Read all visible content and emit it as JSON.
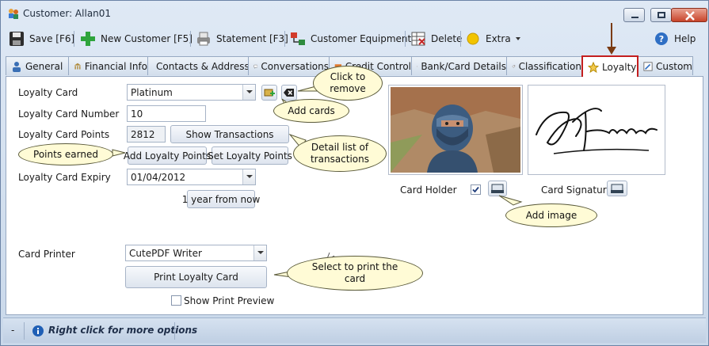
{
  "window": {
    "title": "Customer: Allan01"
  },
  "toolbar": {
    "save_label": "Save [F6]",
    "new_customer_label": "New Customer [F5]",
    "statement_label": "Statement [F3]",
    "customer_equipment_label": "Customer Equipment",
    "delete_label": "Delete",
    "extra_label": "Extra",
    "help_label": "Help"
  },
  "tabs": [
    {
      "label": "General"
    },
    {
      "label": "Financial Info"
    },
    {
      "label": "Contacts & Address"
    },
    {
      "label": "Conversations"
    },
    {
      "label": "Credit Control"
    },
    {
      "label": "Bank/Card Details"
    },
    {
      "label": "Classification"
    },
    {
      "label": "Loyalty"
    },
    {
      "label": "Custom"
    }
  ],
  "loyalty": {
    "card_label": "Loyalty Card",
    "card_value": "Platinum",
    "number_label": "Loyalty Card Number",
    "number_value": "10",
    "points_label": "Loyalty Card Points",
    "points_value": "2812",
    "show_transactions_label": "Show Transactions",
    "add_points_label": "Add Loyalty Points",
    "set_points_label": "Set Loyalty Points",
    "expiry_label": "Loyalty Card Expiry",
    "expiry_value": "01/04/2012",
    "year_from_now_label": "1 year from now",
    "printer_label": "Card Printer",
    "printer_value": "CutePDF Writer",
    "print_card_label": "Print Loyalty Card",
    "show_preview_label": "Show Print Preview",
    "card_holder_label": "Card Holder",
    "card_holder_checked": true,
    "card_signature_label": "Card Signature"
  },
  "callouts": {
    "remove": "Click to remove",
    "add_cards": "Add cards",
    "points_earned": "Points earned",
    "detail_list": "Detail list of transactions",
    "add_image": "Add image",
    "print_card": "Select to print the card"
  },
  "statusbar": {
    "menu_label": "-",
    "hint": "Right click for more options"
  },
  "colors": {
    "active_tab_border": "#c41e1e",
    "callout_fill": "#fffbd6",
    "arrow": "#7a3b12"
  }
}
